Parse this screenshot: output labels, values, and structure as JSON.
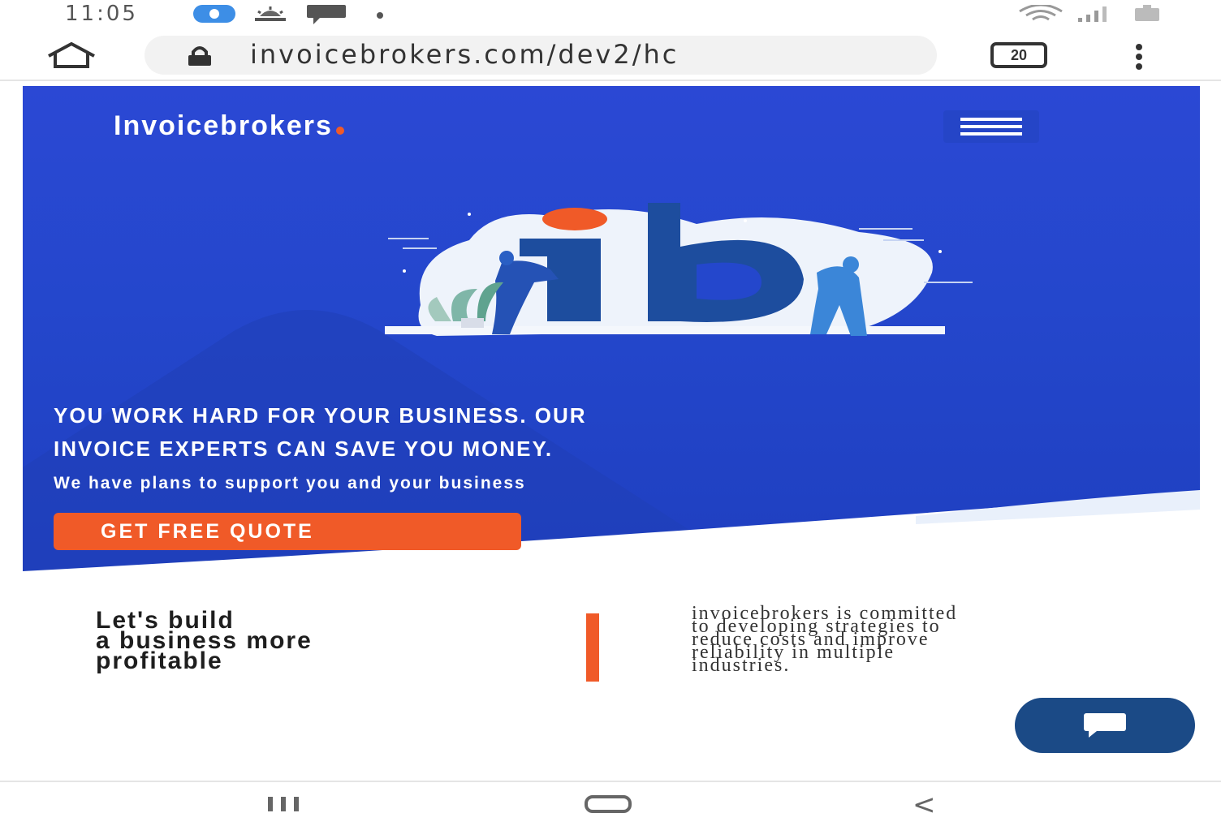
{
  "status_bar": {
    "time": "11:05",
    "left_icons": [
      "messenger-icon",
      "weather-icon",
      "chat-notification-icon",
      "dot-icon"
    ],
    "right_icons": [
      "wifi-icon",
      "signal-icon",
      "battery-icon"
    ]
  },
  "browser": {
    "url": "invoicebrokers.com/dev2/hc",
    "tab_count": "20"
  },
  "hero": {
    "brand": "Invoicebrokers",
    "headline_line1": "YOU WORK HARD FOR YOUR BUSINESS. OUR",
    "headline_line2": "INVOICE EXPERTS CAN SAVE YOU MONEY.",
    "subline": "We have plans to support you and your business",
    "cta_label": "GET FREE QUOTE"
  },
  "info": {
    "tagline_line1": "Let's build",
    "tagline_line2": "a business more",
    "tagline_line3": "profitable",
    "commitment_line1": "invoicebrokers is committed",
    "commitment_line2": "to developing strategies to",
    "commitment_line3": "reduce costs and improve",
    "commitment_line4": "reliability in multiple",
    "commitment_line5": "industries."
  },
  "colors": {
    "hero_blue": "#2447cc",
    "accent_orange": "#f05a28",
    "chat_navy": "#1b4a86"
  }
}
